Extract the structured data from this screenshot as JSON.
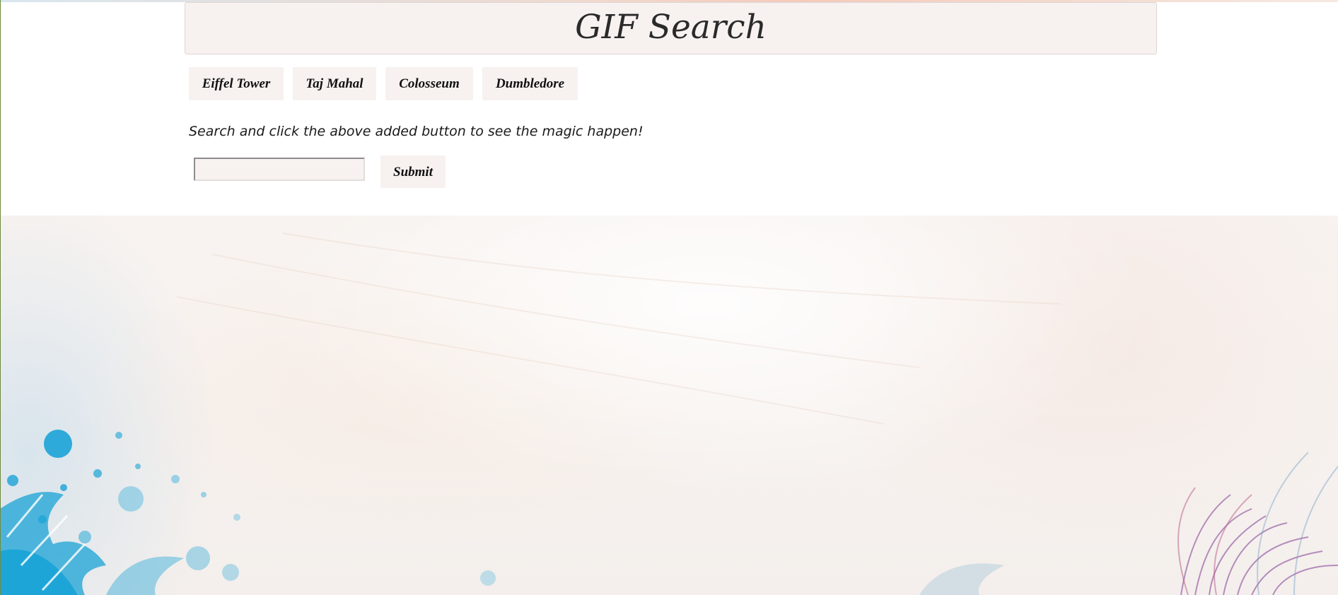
{
  "header": {
    "title": "GIF Search"
  },
  "topics": [
    {
      "label": "Eiffel Tower"
    },
    {
      "label": "Taj Mahal"
    },
    {
      "label": "Colosseum"
    },
    {
      "label": "Dumbledore"
    }
  ],
  "search": {
    "hint": "Search and click the above added button to see the magic happen!",
    "value": "",
    "placeholder": "",
    "submit_label": "Submit"
  },
  "colors": {
    "panel_bg": "#f7f1f0",
    "text": "#111111",
    "accent_splash": "#1aa3d6",
    "accent_grass": "#8a4a9a"
  }
}
